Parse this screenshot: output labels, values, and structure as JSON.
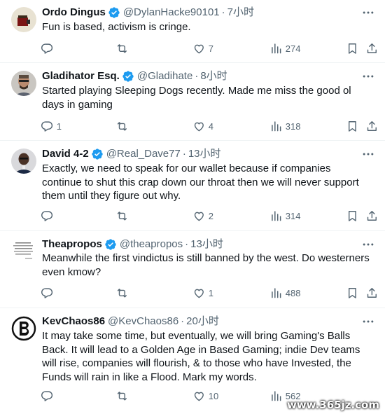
{
  "tweets": [
    {
      "name": "Ordo Dingus",
      "verified": true,
      "handle": "@DylanHacke90101",
      "time": "7小时",
      "text": "Fun is based, activism is cringe.",
      "replies": "",
      "retweets": "",
      "likes": "7",
      "views": "274",
      "avatar": "ordo-avatar"
    },
    {
      "name": "Gladihator Esq.",
      "verified": true,
      "handle": "@Gladihate",
      "time": "8小时",
      "text": "Started playing Sleeping Dogs recently. Made me miss the good ol days in gaming",
      "replies": "1",
      "retweets": "",
      "likes": "4",
      "views": "318",
      "avatar": "gladihator-avatar"
    },
    {
      "name": "David 4-2",
      "verified": true,
      "handle": "@Real_Dave77",
      "time": "13小时",
      "text": "Exactly, we need to speak for our wallet because if companies continue to shut this crap down our throat then we will never support them until they figure out why.",
      "replies": "",
      "retweets": "",
      "likes": "2",
      "views": "314",
      "avatar": "david-avatar"
    },
    {
      "name": "Theapropos",
      "verified": true,
      "handle": "@theapropos",
      "time": "13小时",
      "text": "Meanwhile the first vindictus is still banned by the west. Do westerners even kmow?",
      "replies": "",
      "retweets": "",
      "likes": "1",
      "views": "488",
      "avatar": "theapropos-avatar"
    },
    {
      "name": "KevChaos86",
      "verified": false,
      "handle": "@KevChaos86",
      "time": "20小时",
      "text": "It may take some time, but eventually, we will bring Gaming's Balls Back. It will lead to a Golden Age in Based Gaming; indie Dev teams will rise, companies will flourish, & to those who have Invested, the Funds will rain in like a Flood. Mark my words.",
      "replies": "",
      "retweets": "",
      "likes": "10",
      "views": "562",
      "avatar": "kevchaos-avatar"
    }
  ],
  "separator": "·",
  "colors": {
    "verified": "#1d9bf0",
    "secondary": "#536471",
    "text": "#0f1419",
    "border": "#eff3f4"
  },
  "icons": [
    "reply-icon",
    "retweet-icon",
    "heart-icon",
    "views-icon",
    "bookmark-icon",
    "share-icon",
    "more-icon",
    "verified-badge-icon"
  ],
  "watermark": "www.365jz.com"
}
